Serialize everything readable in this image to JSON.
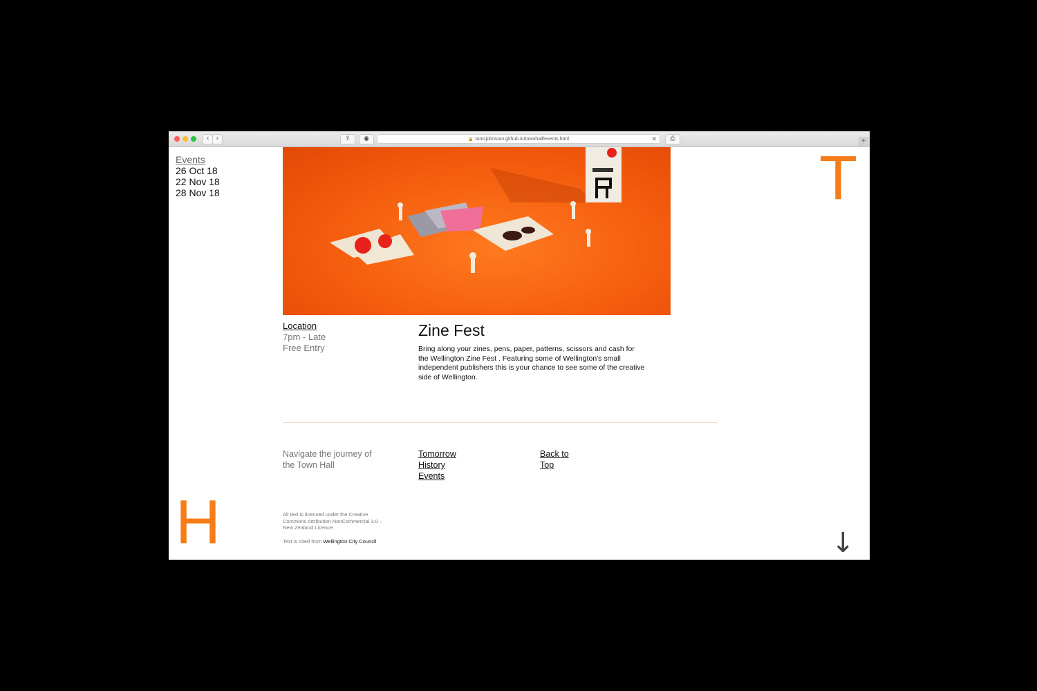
{
  "browser": {
    "url": "tomcjohnston.github.io/townhall/events.html",
    "back_glyph": "‹",
    "forward_glyph": "›",
    "share_glyph": "⇪",
    "reader_glyph": "◉",
    "print_glyph": "⎙",
    "close_glyph": "✕",
    "new_tab_glyph": "+"
  },
  "sidebar": {
    "title": "Events",
    "dates": [
      "26 Oct 18",
      "22 Nov 18",
      "28 Nov 18"
    ]
  },
  "brand": {
    "top_letter": "T",
    "bottom_letter": "H",
    "accent_color": "#f57c17"
  },
  "event": {
    "location_label": "Location",
    "time": "7pm - Late",
    "entry": "Free Entry",
    "title": "Zine Fest",
    "description": "Bring along your zines, pens, paper, patterns, scissors and cash for the Wellington Zine Fest . Featuring some of Wellington's small independent publishers this is your chance to see some of the creative side of Wellington."
  },
  "footer": {
    "caption": "Navigate the journey of the Town Hall",
    "links": [
      "Tomorrow",
      "History",
      "Events"
    ],
    "back_to_top": "Back to Top",
    "license": "All text is licensed under the Creative Commons Attribution NonCommercial 3.0 – New Zealand Licence.",
    "cite_prefix": "Text is cited from",
    "cite_source": "Wellington City Council",
    "arrow_glyph": "↓"
  }
}
